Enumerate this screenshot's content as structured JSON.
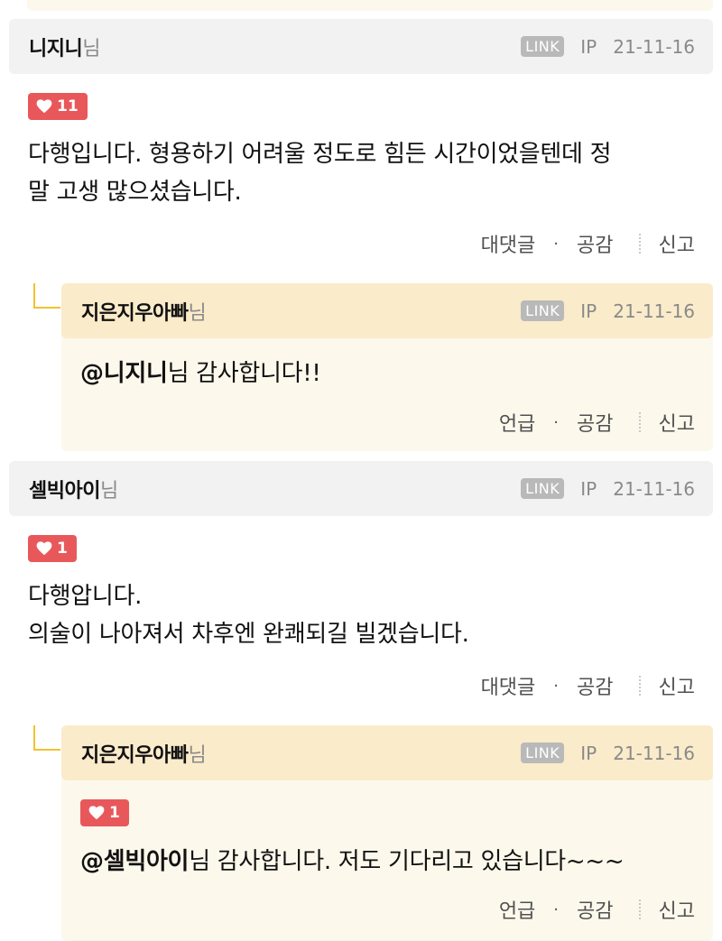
{
  "comments": [
    {
      "author": "니지니",
      "suffix": "님",
      "link_label": "LINK",
      "ip_label": "IP",
      "date": "21-11-16",
      "likes": "11",
      "lines": [
        "다행입니다. 형용하기 어려울 정도로 힘든 시간이었을텐데 정",
        "말 고생 많으셨습니다."
      ],
      "actions": {
        "reply": "대댓글",
        "empathy": "공감",
        "report": "신고"
      },
      "reply": {
        "author": "지은지우아빠",
        "suffix": "님",
        "link_label": "LINK",
        "ip_label": "IP",
        "date": "21-11-16",
        "mention": "@니지니",
        "text": "님 감사합니다!!",
        "actions": {
          "mention": "언급",
          "empathy": "공감",
          "report": "신고"
        }
      }
    },
    {
      "author": "셀빅아이",
      "suffix": "님",
      "link_label": "LINK",
      "ip_label": "IP",
      "date": "21-11-16",
      "likes": "1",
      "lines": [
        "다행압니다.",
        "의술이 나아져서 차후엔 완쾌되길 빌겠습니다."
      ],
      "actions": {
        "reply": "대댓글",
        "empathy": "공감",
        "report": "신고"
      },
      "reply": {
        "author": "지은지우아빠",
        "suffix": "님",
        "link_label": "LINK",
        "ip_label": "IP",
        "date": "21-11-16",
        "likes": "1",
        "mention": "@셀빅아이",
        "text": "님 감사합니다. 저도 기다리고 있습니다~~~",
        "actions": {
          "mention": "언급",
          "empathy": "공감",
          "report": "신고"
        }
      }
    }
  ],
  "colors": {
    "like_badge": "#e8585b",
    "comment_header": "#f2f2f2",
    "reply_header": "#faebca",
    "reply_body": "#fdf8ec",
    "connector": "#f0c330"
  },
  "icons": {
    "like": "heart-icon"
  }
}
